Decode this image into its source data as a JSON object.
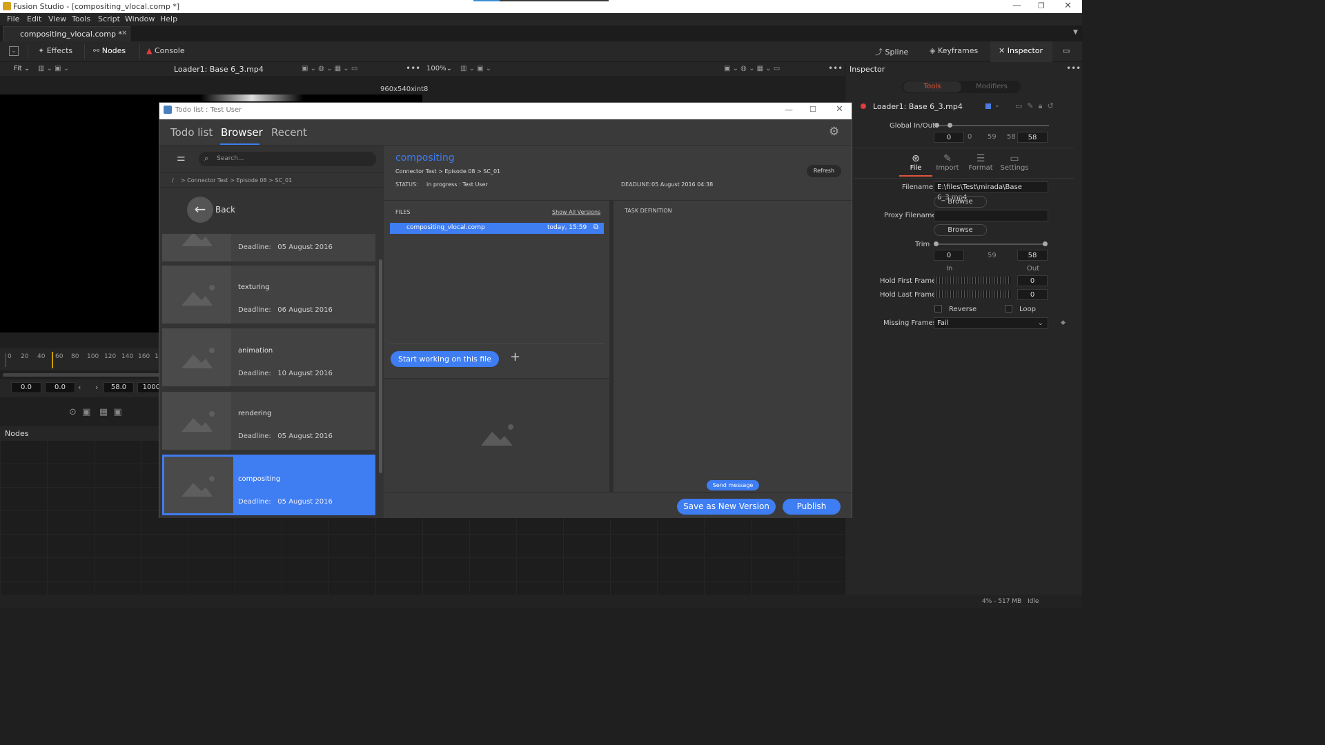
{
  "window": {
    "title": "Fusion Studio - [compositing_vlocal.comp *]"
  },
  "menu": [
    "File",
    "Edit",
    "View",
    "Tools",
    "Script",
    "Window",
    "Help"
  ],
  "tab": {
    "label": "compositing_vlocal.comp *",
    "close": "✕"
  },
  "toolbar": {
    "effects": "Effects",
    "nodes": "Nodes",
    "console": "Console",
    "spline": "Spline",
    "keyframes": "Keyframes",
    "inspector": "Inspector"
  },
  "viewer": {
    "fit": "Fit",
    "title": "Loader1: Base 6_3.mp4",
    "zoom": "100%",
    "resolution": "960x540xint8"
  },
  "timeline": {
    "ticks": [
      "0",
      "20",
      "40",
      "60",
      "80",
      "100",
      "120",
      "140",
      "160",
      "1"
    ],
    "values": [
      "0.0",
      "0.0",
      "58.0",
      "1000."
    ]
  },
  "nodes": {
    "header": "Nodes"
  },
  "inspector": {
    "header": "Inspector",
    "tab_tools": "Tools",
    "tab_modifiers": "Modifiers",
    "tool_name": "Loader1: Base 6_3.mp4",
    "global_inout": "Global In/Out",
    "global_in": "0",
    "global_mid1": "0",
    "global_mid2": "59",
    "global_mid3": "58",
    "global_out": "58",
    "subtabs": [
      "File",
      "Import",
      "Format",
      "Settings"
    ],
    "filename_label": "Filename",
    "filename_value": "E:\\files\\Test\\mirada\\Base 6_3.mp4",
    "browse": "Browse",
    "proxy_label": "Proxy Filename",
    "proxy_value": "",
    "trim_label": "Trim",
    "trim_in": "0",
    "trim_mid": "59",
    "trim_out": "58",
    "in_label": "In",
    "out_label": "Out",
    "hold_first_label": "Hold First Frame",
    "hold_first": "0",
    "hold_last_label": "Hold Last Frame",
    "hold_last": "0",
    "reverse": "Reverse",
    "loop": "Loop",
    "missing_label": "Missing Frames",
    "missing_value": "Fail"
  },
  "status": {
    "memory": "4% - 517 MB",
    "state": "Idle"
  },
  "dialog": {
    "title": "Todo list : Test User",
    "tabs": [
      "Todo list",
      "Browser",
      "Recent"
    ],
    "active_tab": 1,
    "search_placeholder": "Search...",
    "breadcrumb": "/    > Connector Test > Episode 08 > SC_01",
    "back": "Back",
    "deadline_label": "Deadline:",
    "tasks": [
      {
        "name": "",
        "deadline": "05 August 2016",
        "selected": false
      },
      {
        "name": "texturing",
        "deadline": "06 August 2016",
        "selected": false
      },
      {
        "name": "animation",
        "deadline": "10 August 2016",
        "selected": false
      },
      {
        "name": "rendering",
        "deadline": "05 August 2016",
        "selected": false
      },
      {
        "name": "compositing",
        "deadline": "05 August 2016",
        "selected": true
      }
    ],
    "task_title": "compositing",
    "task_path": "Connector Test > Episode 08 > SC_01",
    "status_label": "STATUS:",
    "status_value": "in progress : Test User",
    "deadline_caption": "DEADLINE:",
    "deadline_value": "05 August 2016 04:38",
    "refresh": "Refresh",
    "files_label": "FILES",
    "show_all": "Show All Versions",
    "file_name": "compositing_vlocal.comp",
    "file_time": "today, 15:59",
    "start_working": "Start working on this file",
    "add": "+",
    "task_definition": "TASK DEFINITION",
    "send_message": "Send message",
    "save_new_version": "Save as New Version",
    "publish": "Publish"
  },
  "colors": {
    "accent": "#3e7df2",
    "selected": "#3e7df2",
    "bg": "#1f1f1f"
  }
}
